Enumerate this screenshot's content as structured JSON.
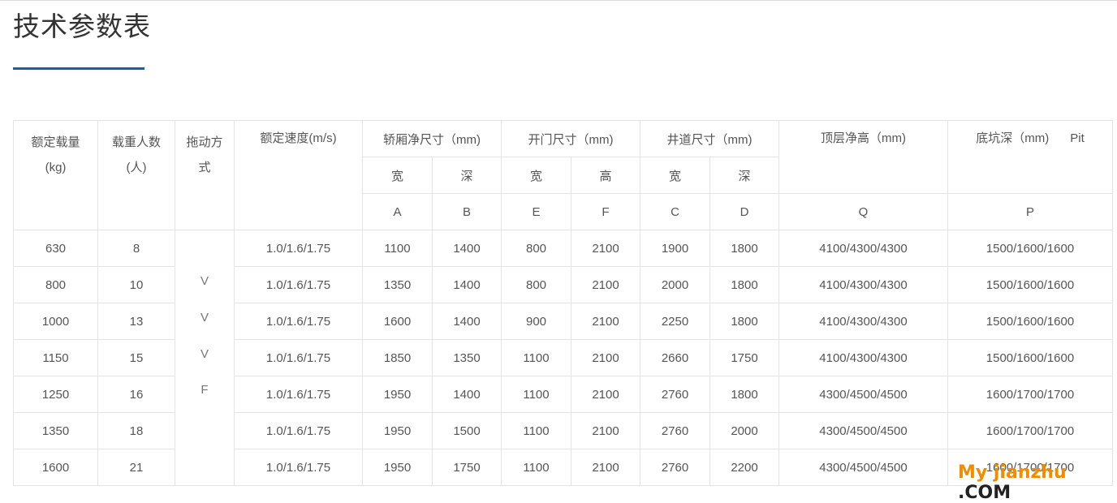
{
  "title": "技术参数表",
  "headers": {
    "load_l1": "额定载量",
    "load_l2": "(kg)",
    "persons_l1": "载重人数",
    "persons_l2": "(人)",
    "drive_l1": "拖动方",
    "drive_l2": "式",
    "speed": "额定速度(m/s)",
    "car_size": "轿厢净尺寸（mm)",
    "door_size": "开门尺寸（mm)",
    "shaft_size": "井道尺寸（mm)",
    "overhead": "顶层净高（mm)",
    "pit": "底坑深（mm)",
    "pit_en": "Pit",
    "car_w": "宽",
    "car_d": "深",
    "door_w": "宽",
    "door_h": "高",
    "shaft_w": "宽",
    "shaft_d": "深",
    "code_a": "A",
    "code_b": "B",
    "code_e": "E",
    "code_f": "F",
    "code_c": "C",
    "code_d": "D",
    "code_q": "Q",
    "code_p": "P"
  },
  "drive_letters": [
    "V",
    "V",
    "V",
    "F"
  ],
  "rows": [
    [
      "630",
      "8",
      "1.0/1.6/1.75",
      "1100",
      "1400",
      "800",
      "2100",
      "1900",
      "1800",
      "4100/4300/4300",
      "1500/1600/1600"
    ],
    [
      "800",
      "10",
      "1.0/1.6/1.75",
      "1350",
      "1400",
      "800",
      "2100",
      "2000",
      "1800",
      "4100/4300/4300",
      "1500/1600/1600"
    ],
    [
      "1000",
      "13",
      "1.0/1.6/1.75",
      "1600",
      "1400",
      "900",
      "2100",
      "2250",
      "1800",
      "4100/4300/4300",
      "1500/1600/1600"
    ],
    [
      "1150",
      "15",
      "1.0/1.6/1.75",
      "1850",
      "1350",
      "1100",
      "2100",
      "2660",
      "1750",
      "4100/4300/4300",
      "1500/1600/1600"
    ],
    [
      "1250",
      "16",
      "1.0/1.6/1.75",
      "1950",
      "1400",
      "1100",
      "2100",
      "2760",
      "1800",
      "4300/4500/4500",
      "1600/1700/1700"
    ],
    [
      "1350",
      "18",
      "1.0/1.6/1.75",
      "1950",
      "1500",
      "1100",
      "2100",
      "2760",
      "2000",
      "4300/4500/4500",
      "1600/1700/1700"
    ],
    [
      "1600",
      "21",
      "1.0/1.6/1.75",
      "1950",
      "1750",
      "1100",
      "2100",
      "2760",
      "2200",
      "4300/4500/4500",
      "1600/1700/1700"
    ]
  ],
  "watermark": {
    "part1": "My jianzhu",
    "part2": " .COM"
  }
}
